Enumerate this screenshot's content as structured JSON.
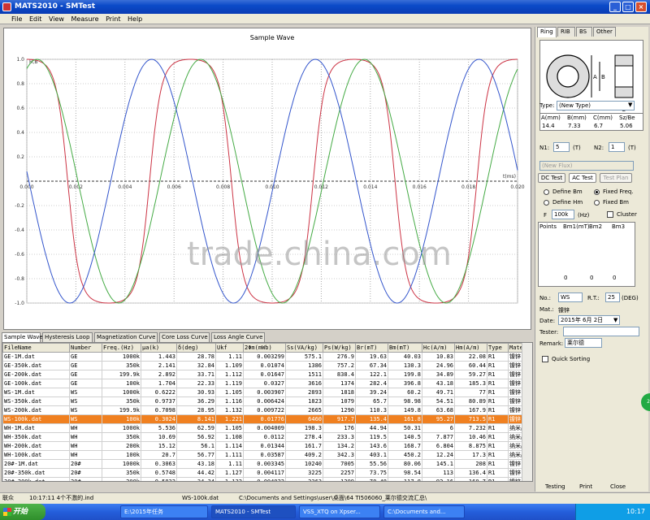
{
  "window": {
    "title": "MATS2010 - SMTest"
  },
  "menu": [
    "File",
    "Edit",
    "View",
    "Measure",
    "Print",
    "Help"
  ],
  "chart_data": {
    "type": "line",
    "title": "Sample Wave",
    "xlabel": "t(ms)",
    "ylabel": "H,B",
    "xlim": [
      0,
      0.02
    ],
    "ylim": [
      -1.0,
      1.0
    ],
    "x_ticks": [
      "0.000",
      "0.002",
      "0.004",
      "0.006",
      "0.008",
      "0.010",
      "0.012",
      "0.014",
      "0.016",
      "0.018",
      "0.020"
    ],
    "y_ticks": [
      "1.0",
      "0.8",
      "0.6",
      "0.4",
      "0.2",
      "-0.2",
      "-0.4",
      "-0.6",
      "-0.8",
      "-1.0"
    ],
    "grid": true,
    "series": [
      {
        "color": "#cc3344",
        "kind": "flat-top",
        "period": 0.00667,
        "phase": 0.0
      },
      {
        "color": "#44aa44",
        "kind": "sine",
        "period": 0.00667,
        "phase": 0.00125
      },
      {
        "color": "#3355cc",
        "kind": "sine",
        "period": 0.00667,
        "phase": 0.00325
      }
    ]
  },
  "watermark": "trade.china.com",
  "bottom_tabs": [
    "Sample Wave",
    "Hysteresis Loop",
    "Magnetization Curve",
    "Core Loss Curve",
    "Loss Angle Curve"
  ],
  "table": {
    "headers": [
      "FileName",
      "Number",
      "Freq.(Hz)",
      "μa(k)",
      "δ(deg)",
      "Ukf",
      "2Φm(mWb)",
      "Ss(VA/kg)",
      "Ps(W/kg)",
      "Br(mT)",
      "Bm(mT)",
      "Hc(A/m)",
      "Hm(A/m)",
      "Type",
      "Materi"
    ],
    "rows": [
      [
        "GE-1M.dat",
        "GE",
        "1000k",
        "1.443",
        "28.78",
        "1.11",
        "0.003299",
        "575.1",
        "276.9",
        "19.63",
        "40.03",
        "10.83",
        "22.08",
        "R1",
        "镍锌"
      ],
      [
        "GE-350k.dat",
        "GE",
        "350k",
        "2.141",
        "32.84",
        "1.109",
        "0.01074",
        "1386",
        "757.2",
        "67.34",
        "130.3",
        "24.96",
        "60.44",
        "R1",
        "镍锌"
      ],
      [
        "GE-200k.dat",
        "GE",
        "199.9k",
        "2.892",
        "33.71",
        "1.112",
        "0.01647",
        "1511",
        "838.4",
        "122.1",
        "199.8",
        "34.89",
        "59.27",
        "R1",
        "镍锌"
      ],
      [
        "GE-100k.dat",
        "GE",
        "100k",
        "1.704",
        "22.33",
        "1.119",
        "0.0327",
        "3616",
        "1374",
        "282.4",
        "396.8",
        "43.18",
        "185.3",
        "R1",
        "镍锌"
      ],
      [
        "WS-1M.dat",
        "WS",
        "1000k",
        "0.6222",
        "30.93",
        "1.105",
        "0.003907",
        "2893",
        "1818",
        "39.24",
        "60.2",
        "49.71",
        "77",
        "R1",
        "镍锌"
      ],
      [
        "WS-350k.dat",
        "WS",
        "350k",
        "0.9737",
        "36.29",
        "1.116",
        "0.006424",
        "1823",
        "1079",
        "65.7",
        "98.98",
        "54.51",
        "80.89",
        "R1",
        "镍锌"
      ],
      [
        "WS-200k.dat",
        "WS",
        "199.9k",
        "0.7098",
        "28.95",
        "1.132",
        "0.009722",
        "2665",
        "1290",
        "110.3",
        "149.8",
        "63.68",
        "167.9",
        "R1",
        "镍锌"
      ],
      [
        "WS-100k.dat",
        "WS",
        "100k",
        "0.3024",
        "8.141",
        "1.221",
        "0.01776",
        "6460",
        "917.7",
        "135.4",
        "161.8",
        "95.27",
        "713.5",
        "R1",
        "镍锌"
      ],
      [
        "WH-1M.dat",
        "WH",
        "1000k",
        "5.536",
        "62.59",
        "1.105",
        "0.004009",
        "198.3",
        "176",
        "44.94",
        "50.31",
        "6",
        "7.232",
        "R1",
        "纳米晶"
      ],
      [
        "WH-350k.dat",
        "WH",
        "350k",
        "10.69",
        "56.92",
        "1.108",
        "0.0112",
        "278.4",
        "233.3",
        "119.5",
        "140.5",
        "7.877",
        "10.46",
        "R1",
        "纳米晶"
      ],
      [
        "WH-200k.dat",
        "WH",
        "200k",
        "15.12",
        "56.1",
        "1.114",
        "0.01344",
        "161.7",
        "134.2",
        "143.6",
        "168.7",
        "6.804",
        "8.875",
        "R1",
        "纳米晶"
      ],
      [
        "WH-100k.dat",
        "WH",
        "100k",
        "20.7",
        "56.77",
        "1.111",
        "0.03587",
        "409.2",
        "342.3",
        "403.1",
        "450.2",
        "12.24",
        "17.3",
        "R1",
        "纳米晶"
      ],
      [
        "20#-1M.dat",
        "20#",
        "1000k",
        "0.3063",
        "43.18",
        "1.11",
        "0.003345",
        "10240",
        "7005",
        "55.56",
        "80.06",
        "145.1",
        "208",
        "R1",
        "镍锌"
      ],
      [
        "20#-350k.dat",
        "20#",
        "350k",
        "0.5748",
        "44.42",
        "1.127",
        "0.004117",
        "3225",
        "2257",
        "73.75",
        "98.54",
        "113",
        "136.4",
        "R1",
        "镍锌"
      ],
      [
        "20#-200k.dat",
        "20#",
        "200k",
        "0.5832",
        "34.34",
        "1.132",
        "0.004922",
        "2363",
        "1299",
        "78.48",
        "117.8",
        "92.16",
        "160.7",
        "R1",
        "镍锌"
      ]
    ],
    "selected_index": 7
  },
  "status": {
    "left_icon_text": "联众",
    "time_msg": "10:17:11 4个不激的.ind",
    "file": "WS-100k.dat",
    "path": "C:\\Documents and Settings\\user\\桌面\\64 TI506060_莱尔德交流汇总\\"
  },
  "right_panel": {
    "tabs": [
      "Ring",
      "RIB",
      "BS",
      "Other"
    ],
    "type_label": "Type:",
    "type_value": "(New Type)",
    "dim_headers": [
      "A(mm)",
      "B(mm)",
      "C(mm)",
      "Sz/Be"
    ],
    "dim_values": [
      "14.4",
      "7.33",
      "6.7",
      "5.06"
    ],
    "n1_label": "N1:",
    "n1_value": "5",
    "n1_unit": "(T)",
    "n2_label": "N2:",
    "n2_value": "1",
    "n2_unit": "(T)",
    "flux_type": "(New Flux)",
    "test_tabs": [
      "DC Test",
      "AC Test",
      "Test Plan"
    ],
    "define_bm": "Define Bm",
    "fixed_freq": "Fixed Freq.",
    "define_hm": "Define Hm",
    "fixed_bm": "Fixed Bm",
    "f_label": "F",
    "f_value": "100k",
    "f_unit": "(Hz)",
    "cluster": "Cluster",
    "points_headers": [
      "Points",
      "Bm1(mT)",
      "Bm2",
      "Bm3"
    ],
    "points_row": [
      "0",
      "0",
      "0"
    ],
    "no_label": "No.:",
    "no_value": "WS",
    "rt_label": "R.T.:",
    "rt_value": "25",
    "rt_unit": "(DEG)",
    "mat_label": "Mat.:",
    "mat_value": "镍锌",
    "date_label": "Date:",
    "date_value": "2015年 6月 2日",
    "tester_label": "Tester:",
    "tester_value": "",
    "remark_label": "Remark:",
    "remark_value": "莱尔德",
    "quick_sort": "Quick Sorting",
    "bottom_buttons": [
      "Testing",
      "Print",
      "Close"
    ]
  },
  "taskbar": {
    "start": "开始",
    "items": [
      "E:\\2015年任务",
      "MATS2010 - SMTest",
      "VSS_XTQ on Xpser...",
      "C:\\Documents and..."
    ],
    "clock": "10:17"
  }
}
